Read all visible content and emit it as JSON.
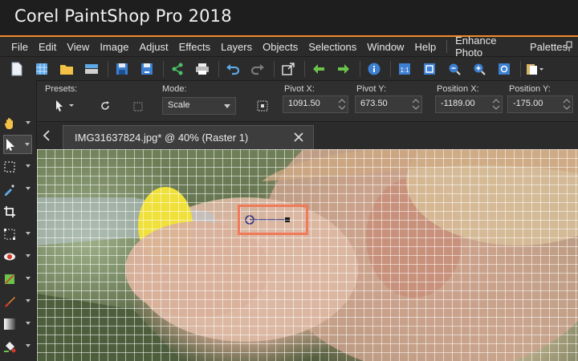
{
  "app": {
    "title": "Corel PaintShop Pro 2018"
  },
  "colors": {
    "accent": "#f08a2a",
    "highlight": "#f07a5a"
  },
  "menu": {
    "items": [
      "File",
      "Edit",
      "View",
      "Image",
      "Adjust",
      "Effects",
      "Layers",
      "Objects",
      "Selections",
      "Window",
      "Help",
      "Enhance Photo",
      "Palettes"
    ]
  },
  "toolbar": {
    "icons": [
      "new-icon",
      "grid-icon",
      "open-icon",
      "scan-icon",
      "save-icon",
      "save-as-icon",
      "share-icon",
      "print-icon",
      "undo-icon",
      "redo-icon",
      "resize-icon",
      "back-icon",
      "forward-icon",
      "info-icon",
      "fit-window-icon",
      "actual-size-icon",
      "zoom-out-icon",
      "zoom-in-icon",
      "zoom-100-icon",
      "paste-icon"
    ]
  },
  "options": {
    "presets_label": "Presets:",
    "mode_label": "Mode:",
    "mode_value": "Scale",
    "pivot_x_label": "Pivot X:",
    "pivot_x_value": "1091.50",
    "pivot_y_label": "Pivot Y:",
    "pivot_y_value": "673.50",
    "position_x_label": "Position X:",
    "position_x_value": "-1189.00",
    "position_y_label": "Position Y:",
    "position_y_value": "-175.00"
  },
  "document": {
    "tab_title": "IMG31637824.jpg* @  40% (Raster 1)"
  },
  "tools": [
    "pan-icon",
    "pick-icon",
    "selection-icon",
    "dropper-icon",
    "crop-icon",
    "transform-icon",
    "red-eye-icon",
    "straighten-icon",
    "paint-brush-icon",
    "gradient-icon",
    "fill-icon"
  ]
}
